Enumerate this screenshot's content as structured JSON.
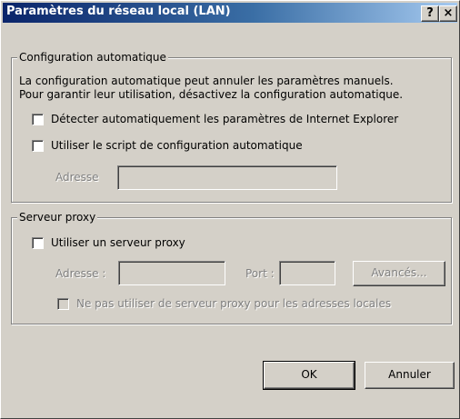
{
  "window": {
    "title": "Paramètres du réseau local (LAN)",
    "help_button": "?",
    "close_button": "×"
  },
  "auto_config": {
    "group_title": "Configuration automatique",
    "description_line1": "La configuration automatique peut annuler les paramètres manuels.",
    "description_line2": "Pour garantir leur utilisation, désactivez la configuration automatique.",
    "detect_label": "Détecter automatiquement les paramètres de Internet Explorer",
    "detect_checked": false,
    "script_label": "Utiliser le script de configuration automatique",
    "script_checked": false,
    "address_label": "Adresse",
    "address_value": ""
  },
  "proxy": {
    "group_title": "Serveur proxy",
    "use_proxy_label": "Utiliser un serveur proxy",
    "use_proxy_checked": false,
    "address_label": "Adresse :",
    "address_value": "",
    "port_label": "Port :",
    "port_value": "",
    "advanced_label": "Avancés...",
    "bypass_local_label": "Ne pas utiliser de serveur proxy pour les adresses locales",
    "bypass_local_checked": false
  },
  "buttons": {
    "ok_label": "OK",
    "cancel_label": "Annuler"
  }
}
